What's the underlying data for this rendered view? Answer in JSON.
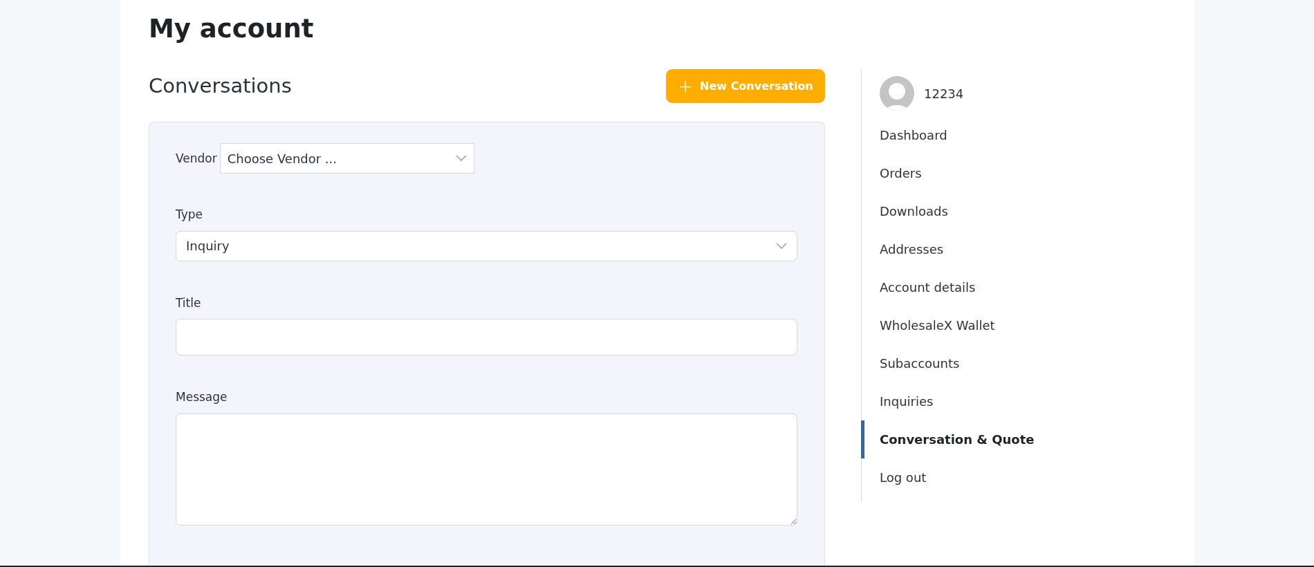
{
  "page_title": "My account",
  "section": {
    "heading": "Conversations",
    "new_button": {
      "icon": "+",
      "label": "New Conversation"
    }
  },
  "form": {
    "fields": [
      {
        "kind": "inline-select",
        "label": "Vendor",
        "value": "Choose Vendor ..."
      },
      {
        "kind": "select",
        "label": "Type",
        "value": "Inquiry"
      },
      {
        "kind": "text",
        "label": "Title"
      },
      {
        "kind": "textarea",
        "label": "Message"
      }
    ]
  },
  "sidebar": {
    "user": {
      "name": "12234"
    },
    "items": [
      {
        "label": "Dashboard",
        "selected": false
      },
      {
        "label": "Orders",
        "selected": false
      },
      {
        "label": "Downloads",
        "selected": false
      },
      {
        "label": "Addresses",
        "selected": false
      },
      {
        "label": "Account details",
        "selected": false
      },
      {
        "label": "WholesaleX Wallet",
        "selected": false
      },
      {
        "label": "Subaccounts",
        "selected": false
      },
      {
        "label": "Inquiries",
        "selected": false
      },
      {
        "label": "Conversation & Quote",
        "selected": true
      },
      {
        "label": "Log out",
        "selected": false
      }
    ]
  }
}
